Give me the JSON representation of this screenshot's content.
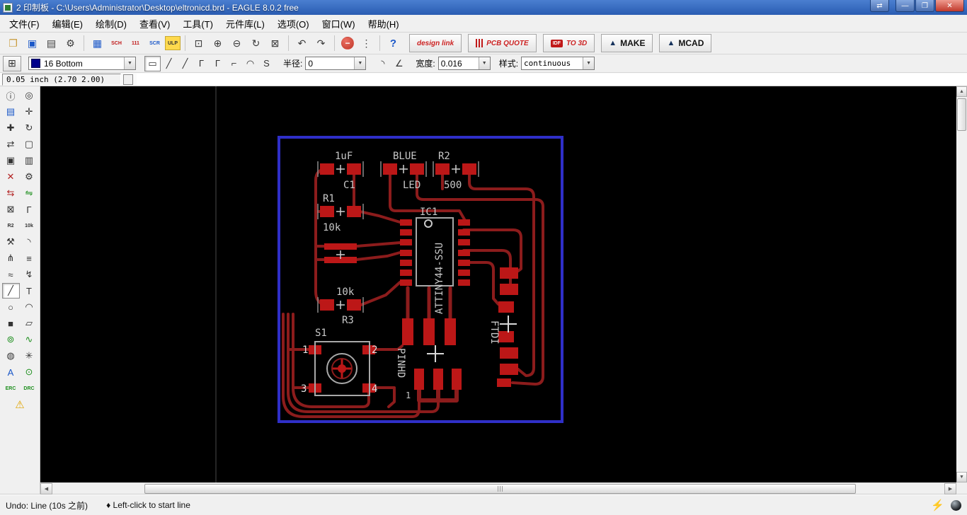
{
  "window": {
    "title": "2 印制板 - C:\\Users\\Administrator\\Desktop\\eltronicd.brd - EAGLE 8.0.2 free",
    "controls": {
      "switch": "⇄",
      "minimize": "—",
      "maximize": "❐",
      "close": "✕"
    }
  },
  "menu": {
    "items": [
      "文件(F)",
      "编辑(E)",
      "绘制(D)",
      "查看(V)",
      "工具(T)",
      "元件库(L)",
      "选项(O)",
      "窗口(W)",
      "帮助(H)"
    ]
  },
  "toolbar1": {
    "items": [
      {
        "name": "open",
        "glyph": "❐"
      },
      {
        "name": "save",
        "glyph": "▣"
      },
      {
        "name": "print",
        "glyph": "▤"
      },
      {
        "name": "cam",
        "glyph": "⚙"
      },
      {
        "name": "board",
        "glyph": "▦"
      },
      {
        "name": "schematic",
        "glyph": "SCH"
      },
      {
        "name": "library",
        "glyph": "111"
      },
      {
        "name": "script",
        "glyph": "SCR"
      },
      {
        "name": "ulp",
        "glyph": "ULP"
      },
      {
        "name": "zoom-fit",
        "glyph": "⊡"
      },
      {
        "name": "zoom-in",
        "glyph": "⊕"
      },
      {
        "name": "zoom-out",
        "glyph": "⊖"
      },
      {
        "name": "zoom-redraw",
        "glyph": "↻"
      },
      {
        "name": "zoom-select",
        "glyph": "⊠"
      },
      {
        "name": "undo",
        "glyph": "↶"
      },
      {
        "name": "redo",
        "glyph": "↷"
      },
      {
        "name": "stop",
        "glyph": "−"
      },
      {
        "name": "more",
        "glyph": "⋮"
      },
      {
        "name": "help",
        "glyph": "?"
      }
    ],
    "brand": {
      "design_link": "design link",
      "pcb_quote": "PCB QUOTE",
      "idf_badge": "IDF",
      "idf_text": "TO 3D",
      "logo": "▲",
      "make": "MAKE",
      "mcad": "MCAD"
    }
  },
  "toolbar2": {
    "grid_glyph": "⊞",
    "layer_value": "16 Bottom",
    "layer_color": "#00008b",
    "bends": [
      "▭",
      "╱",
      "╱",
      "Γ",
      "Γ",
      "⌐",
      "◠",
      "S"
    ],
    "radius_label": "半径:",
    "radius_value": "0",
    "miters": [
      "◝",
      "∠"
    ],
    "width_label": "宽度:",
    "width_value": "0.016",
    "style_label": "样式:",
    "style_value": "continuous",
    "arrow": "▼"
  },
  "coords": {
    "position": "0.05 inch (2.70 2.00)"
  },
  "scroll": {
    "up": "▲",
    "down": "▼",
    "left": "◀",
    "right": "▶"
  },
  "status": {
    "undo_text": "Undo: Line (10s 之前)",
    "hint_text": "♦ Left-click to start line",
    "bolt": "⚡"
  },
  "sidebar": {
    "tools": [
      {
        "name": "info",
        "glyph": "ⓘ"
      },
      {
        "name": "show",
        "glyph": "◎"
      },
      {
        "name": "display",
        "glyph": "▤"
      },
      {
        "name": "mark",
        "glyph": "✛"
      },
      {
        "name": "move",
        "glyph": "✚"
      },
      {
        "name": "rotate",
        "glyph": "↻"
      },
      {
        "name": "mirror",
        "glyph": "⇄"
      },
      {
        "name": "group",
        "glyph": "▢"
      },
      {
        "name": "copy",
        "glyph": "▣"
      },
      {
        "name": "paste",
        "glyph": "▥"
      },
      {
        "name": "delete",
        "glyph": "✕"
      },
      {
        "name": "change",
        "glyph": "⚙"
      },
      {
        "name": "replace",
        "glyph": "⇆"
      },
      {
        "name": "pinswap",
        "glyph": "⇋"
      },
      {
        "name": "lock",
        "glyph": "⊠"
      },
      {
        "name": "route",
        "glyph": "Γ"
      },
      {
        "name": "name",
        "glyph": "R2"
      },
      {
        "name": "value",
        "glyph": "10k"
      },
      {
        "name": "smash",
        "glyph": "⚒"
      },
      {
        "name": "miter",
        "glyph": "◝"
      },
      {
        "name": "split",
        "glyph": "⋔"
      },
      {
        "name": "optimize",
        "glyph": "≡"
      },
      {
        "name": "meander",
        "glyph": "≈"
      },
      {
        "name": "ripup",
        "glyph": "↯"
      },
      {
        "name": "wire",
        "glyph": "╱"
      },
      {
        "name": "text",
        "glyph": "T"
      },
      {
        "name": "circle",
        "glyph": "○"
      },
      {
        "name": "arc",
        "glyph": "◠"
      },
      {
        "name": "rect",
        "glyph": "■"
      },
      {
        "name": "polygon",
        "glyph": "▱"
      },
      {
        "name": "via",
        "glyph": "⊚"
      },
      {
        "name": "signal",
        "glyph": "∿"
      },
      {
        "name": "hole",
        "glyph": "◍"
      },
      {
        "name": "ratsnest",
        "glyph": "✳"
      },
      {
        "name": "autoroute",
        "glyph": "A"
      },
      {
        "name": "drill",
        "glyph": "⊙"
      },
      {
        "name": "erc",
        "glyph": "ERC"
      },
      {
        "name": "drc",
        "glyph": "DRC"
      },
      {
        "name": "errors",
        "glyph": "⚠"
      }
    ]
  },
  "pcb": {
    "labels": {
      "c1_value": "1uF",
      "c1_name": "C1",
      "led_value": "BLUE",
      "led_name": "LED",
      "r2_name": "R2",
      "r2_value": "500",
      "r1_name": "R1",
      "r1_value": "10k",
      "r3_value": "10k",
      "r3_name": "R3",
      "s1_name": "S1",
      "pad1": "1",
      "pad2": "2",
      "pad3": "3",
      "pad4": "4",
      "ic1_name": "IC1",
      "ic1_value": "ATTINY44-SSU",
      "pinhd_name": "PINHD",
      "pinhd_pin": "1",
      "ftdi_name": "FTDI"
    }
  }
}
